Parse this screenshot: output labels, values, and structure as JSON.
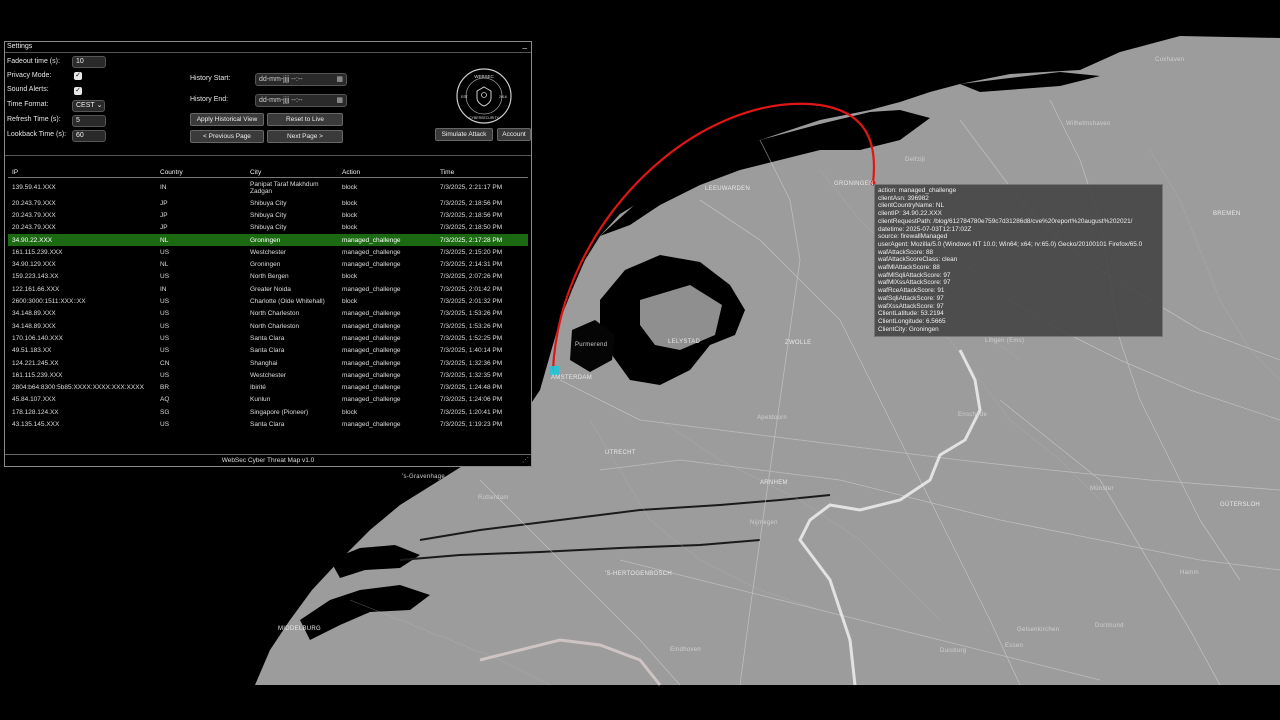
{
  "settings": {
    "title": "Settings",
    "minimize": "_",
    "fadeout_label": "Fadeout time (s):",
    "fadeout_value": "10",
    "privacy_label": "Privacy Mode:",
    "sound_label": "Sound Alerts:",
    "time_format_label": "Time Format:",
    "time_format_value": "CEST",
    "refresh_label": "Refresh Time (s):",
    "refresh_value": "5",
    "lookback_label": "Lookback Time (s):",
    "lookback_value": "60",
    "history_start_label": "History Start:",
    "history_end_label": "History End:",
    "datetime_placeholder": "dd-mm-jjjj --:--",
    "apply_historical": "Apply Historical View",
    "reset_live": "Reset to Live",
    "prev_page": "< Previous Page",
    "next_page": "Next Page >",
    "simulate_attack": "Simulate Attack",
    "account": "Account",
    "logo_top": "WEBSEC",
    "logo_bottom": "CYBERSECURITY",
    "logo_left": "EST",
    "logo_right": "2016",
    "footer": "WebSec Cyber Threat Map v1.0"
  },
  "table": {
    "headers": [
      "IP",
      "Country",
      "City",
      "Action",
      "Time"
    ],
    "rows": [
      {
        "ip": "139.59.41.XXX",
        "country": "IN",
        "city": "Panipat Taraf Makhdum Zadgan",
        "action": "block",
        "time": "7/3/2025, 2:21:17 PM"
      },
      {
        "ip": "20.243.79.XXX",
        "country": "JP",
        "city": "Shibuya City",
        "action": "block",
        "time": "7/3/2025, 2:18:56 PM"
      },
      {
        "ip": "20.243.79.XXX",
        "country": "JP",
        "city": "Shibuya City",
        "action": "block",
        "time": "7/3/2025, 2:18:56 PM"
      },
      {
        "ip": "20.243.79.XXX",
        "country": "JP",
        "city": "Shibuya City",
        "action": "block",
        "time": "7/3/2025, 2:18:50 PM"
      },
      {
        "ip": "34.90.22.XXX",
        "country": "NL",
        "city": "Groningen",
        "action": "managed_challenge",
        "time": "7/3/2025, 2:17:28 PM"
      },
      {
        "ip": "161.115.239.XXX",
        "country": "US",
        "city": "Westchester",
        "action": "managed_challenge",
        "time": "7/3/2025, 2:15:20 PM"
      },
      {
        "ip": "34.90.129.XXX",
        "country": "NL",
        "city": "Groningen",
        "action": "managed_challenge",
        "time": "7/3/2025, 2:14:31 PM"
      },
      {
        "ip": "159.223.143.XX",
        "country": "US",
        "city": "North Bergen",
        "action": "block",
        "time": "7/3/2025, 2:07:26 PM"
      },
      {
        "ip": "122.161.66.XXX",
        "country": "IN",
        "city": "Greater Noida",
        "action": "managed_challenge",
        "time": "7/3/2025, 2:01:42 PM"
      },
      {
        "ip": "2600:3000:1511:XXX::XX",
        "country": "US",
        "city": "Charlotte (Olde Whitehall)",
        "action": "block",
        "time": "7/3/2025, 2:01:32 PM"
      },
      {
        "ip": "34.148.89.XXX",
        "country": "US",
        "city": "North Charleston",
        "action": "managed_challenge",
        "time": "7/3/2025, 1:53:26 PM"
      },
      {
        "ip": "34.148.89.XXX",
        "country": "US",
        "city": "North Charleston",
        "action": "managed_challenge",
        "time": "7/3/2025, 1:53:26 PM"
      },
      {
        "ip": "170.106.140.XXX",
        "country": "US",
        "city": "Santa Clara",
        "action": "managed_challenge",
        "time": "7/3/2025, 1:52:25 PM"
      },
      {
        "ip": "49.51.183.XX",
        "country": "US",
        "city": "Santa Clara",
        "action": "managed_challenge",
        "time": "7/3/2025, 1:40:14 PM"
      },
      {
        "ip": "124.221.245.XX",
        "country": "CN",
        "city": "Shanghai",
        "action": "managed_challenge",
        "time": "7/3/2025, 1:32:36 PM"
      },
      {
        "ip": "161.115.239.XXX",
        "country": "US",
        "city": "Westchester",
        "action": "managed_challenge",
        "time": "7/3/2025, 1:32:35 PM"
      },
      {
        "ip": "2804:b64:8300:5b85:XXXX:XXXX:XXX:XXXX",
        "country": "BR",
        "city": "Ibirité",
        "action": "managed_challenge",
        "time": "7/3/2025, 1:24:48 PM"
      },
      {
        "ip": "45.84.107.XXX",
        "country": "AQ",
        "city": "Kunlun",
        "action": "managed_challenge",
        "time": "7/3/2025, 1:24:06 PM"
      },
      {
        "ip": "178.128.124.XX",
        "country": "SG",
        "city": "Singapore (Pioneer)",
        "action": "block",
        "time": "7/3/2025, 1:20:41 PM"
      },
      {
        "ip": "43.135.145.XXX",
        "country": "US",
        "city": "Santa Clara",
        "action": "managed_challenge",
        "time": "7/3/2025, 1:19:23 PM"
      }
    ]
  },
  "tooltip": {
    "lines": [
      "action: managed_challenge",
      "clientAsn: 396982",
      "clientCountryName: NL",
      "clientIP: 34.90.22.XXX",
      "clientRequestPath: /blog/612784780e759c7d31286d8/cve%20report%20august%202021/",
      "datetime: 2025-07-03T12:17:02Z",
      "source: firewallManaged",
      "userAgent: Mozilla/5.0 (Windows NT 10.0; Win64; x64; rv:65.0) Gecko/20100101 Firefox/65.0",
      "wafAttackScore: 88",
      "wafAttackScoreClass: clean",
      "wafMlAttackScore: 88",
      "wafMlSqliAttackScore: 97",
      "wafMlXssAttackScore: 97",
      "wafRceAttackScore: 91",
      "wafSqliAttackScore: 97",
      "wafXssAttackScore: 97",
      "ClientLatitude: 53.2194",
      "ClientLongitude: 6.5665",
      "ClientCity: Groningen"
    ]
  },
  "map": {
    "labels": {
      "cuxhaven": "Cuxhaven",
      "wilhelmshaven": "Wilhelmshaven",
      "bremen": "BREMEN",
      "leeuwarden": "LEEUWARDEN",
      "groningen": "GRONINGEN",
      "delfzijl": "Delfzijl",
      "zwolle": "ZWOLLE",
      "lelystad": "LELYSTAD",
      "purmerend": "Purmerend",
      "amsterdam": "AMSTERDAM",
      "apeldoorn": "Apeldoorn",
      "enschede": "Enschede",
      "lingen": "Lingen (Ems)",
      "utrecht": "UTRECHT",
      "arnhem": "ARNHEM",
      "nijmegen": "Nijmegen",
      "rotterdam": "Rotterdam",
      "hertogenbosch": "'S-HERTOGENBOSCH",
      "middelburg": "MIDDELBURG",
      "eindhoven": "Eindhoven",
      "munster": "Münster",
      "gutersloh": "GÜTERSLOH",
      "hamm": "Hamm",
      "dortmund": "Dortmund",
      "essen": "Essen",
      "gelsenkirchen": "Gelsenkirchen",
      "duisburg": "Duisburg",
      "gravenhage": "'s-Gravenhage"
    },
    "attack_color": "#e01515",
    "target_color": "#22c5d8"
  }
}
